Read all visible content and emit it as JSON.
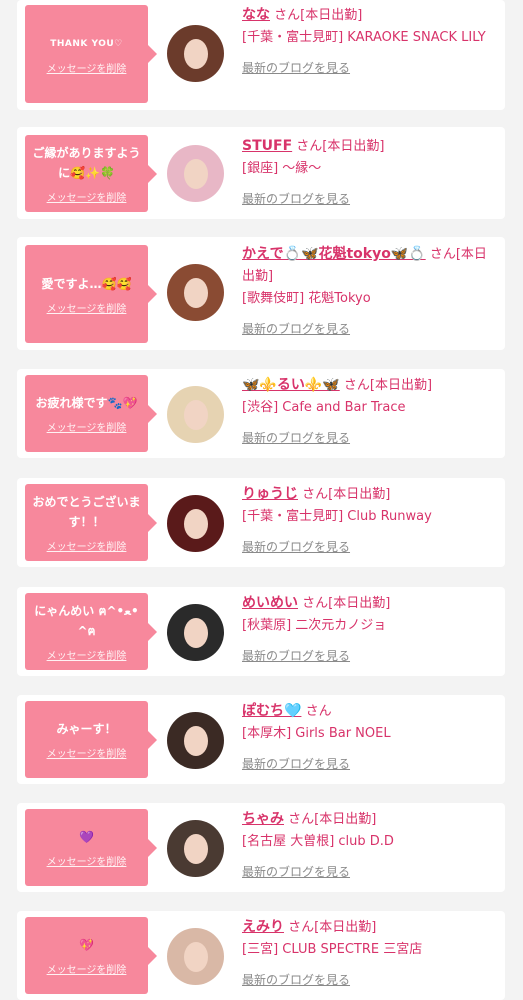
{
  "labels": {
    "delete": "メッセージを削除",
    "blog": "最新のブログを見る"
  },
  "cards": [
    {
      "message": "THANK YOU♡",
      "small": true,
      "name": "なな",
      "suffix": "さん[本日出勤]",
      "shop": "[千葉・富士見町] KARAOKE SNACK LILY",
      "avatar_color": "#6b3b2b"
    },
    {
      "message": "ご縁がありますように🥰✨🍀",
      "small": false,
      "name": "STUFF",
      "suffix": "さん[本日出勤]",
      "shop": "[銀座] 〜縁〜",
      "avatar_color": "#e8b7c6"
    },
    {
      "message": "愛ですよ…🥰🥰",
      "small": false,
      "name": "かえで💍🦋花魁tokyo🦋💍",
      "suffix": "さん[本日出勤]",
      "shop": "[歌舞伎町] 花魁Tokyo",
      "avatar_color": "#8a4b33"
    },
    {
      "message": "お疲れ様です🐾💖",
      "small": false,
      "name": "🦋⚜️るい⚜️🦋",
      "suffix": "さん[本日出勤]",
      "shop": "[渋谷] Cafe and Bar Trace",
      "avatar_color": "#e6d3b2"
    },
    {
      "message": "おめでとうございます！！",
      "small": false,
      "name": "りゅうじ",
      "suffix": "さん[本日出勤]",
      "shop": "[千葉・富士見町] Club Runway",
      "avatar_color": "#5a1a1a"
    },
    {
      "message": "にゃんめい ฅ^•ﻌ•^ฅ",
      "small": false,
      "name": "めいめい",
      "suffix": "さん[本日出勤]",
      "shop": "[秋葉原] 二次元カノジョ",
      "avatar_color": "#2a2a2a"
    },
    {
      "message": "みゃーす！",
      "small": false,
      "name": "ぽむち🩵",
      "suffix": "さん",
      "shop": "[本厚木] Girls Bar NOEL",
      "avatar_color": "#3b2a24"
    },
    {
      "message": "💜",
      "small": false,
      "name": "ちゃみ",
      "suffix": "さん[本日出勤]",
      "shop": "[名古屋 大曽根] club D.D",
      "avatar_color": "#4a3a32"
    },
    {
      "message": "💖",
      "small": false,
      "name": "えみり",
      "suffix": "さん[本日出勤]",
      "shop": "[三宮] CLUB SPECTRE 三宮店",
      "avatar_color": "#d9b8a6"
    }
  ],
  "colors": {
    "accent": "#d8336a",
    "bubble": "#f7889c",
    "background": "#f3f3f3"
  }
}
